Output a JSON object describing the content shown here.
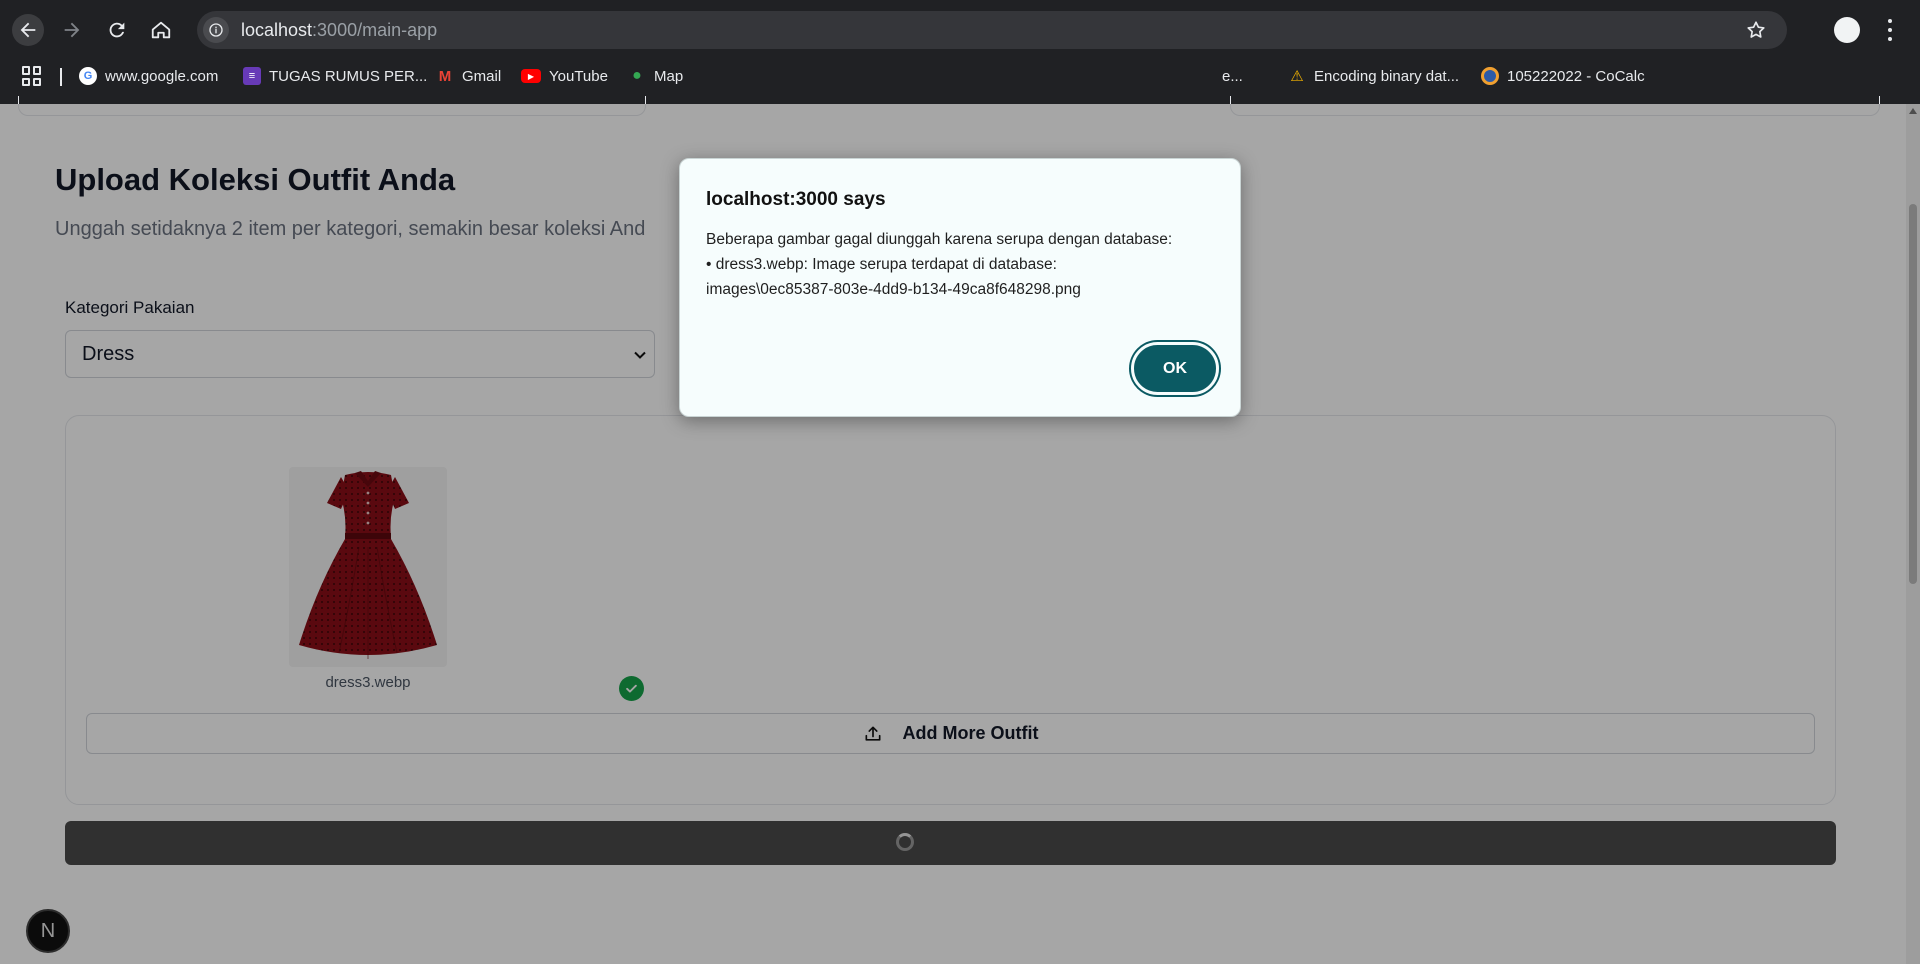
{
  "browser": {
    "url_host": "localhost",
    "url_path": ":3000/main-app"
  },
  "bookmarks": [
    {
      "label": "www.google.com",
      "icon": "google-icon",
      "color": "#4285f4"
    },
    {
      "label": "TUGAS RUMUS PER...",
      "icon": "forms-icon",
      "color": "#673ab7"
    },
    {
      "label": "Gmail",
      "icon": "gmail-icon",
      "color": "#ea4335"
    },
    {
      "label": "YouTube",
      "icon": "youtube-icon",
      "color": "#ff0000"
    },
    {
      "label": "Map",
      "icon": "maps-icon",
      "color": "#34a853"
    },
    {
      "label": "e...",
      "icon": "",
      "color": ""
    },
    {
      "label": "Encoding binary dat...",
      "icon": "road-sign-icon",
      "color": "#f4b400"
    },
    {
      "label": "105222022 - CoCalc",
      "icon": "cocalc-icon",
      "color": "#f0a030"
    }
  ],
  "page": {
    "title": "Upload Koleksi Outfit Anda",
    "subtitle": "Unggah setidaknya 2 item per kategori, semakin besar koleksi And",
    "category_label": "Kategori Pakaian",
    "category_value": "Dress",
    "uploaded_file": "dress3.webp",
    "add_more_label": "Add More Outfit",
    "badge_letter": "N"
  },
  "dialog": {
    "title": "localhost:3000 says",
    "line1": "Beberapa gambar gagal diunggah karena serupa dengan database:",
    "line2": "• dress3.webp: Image serupa terdapat di database:",
    "line3": "images\\0ec85387-803e-4dd9-b134-49ca8f648298.png",
    "ok_label": "OK"
  },
  "colors": {
    "ok_button": "#0b5a63",
    "success_check": "#16a34a",
    "dress": "#8b0f17"
  }
}
